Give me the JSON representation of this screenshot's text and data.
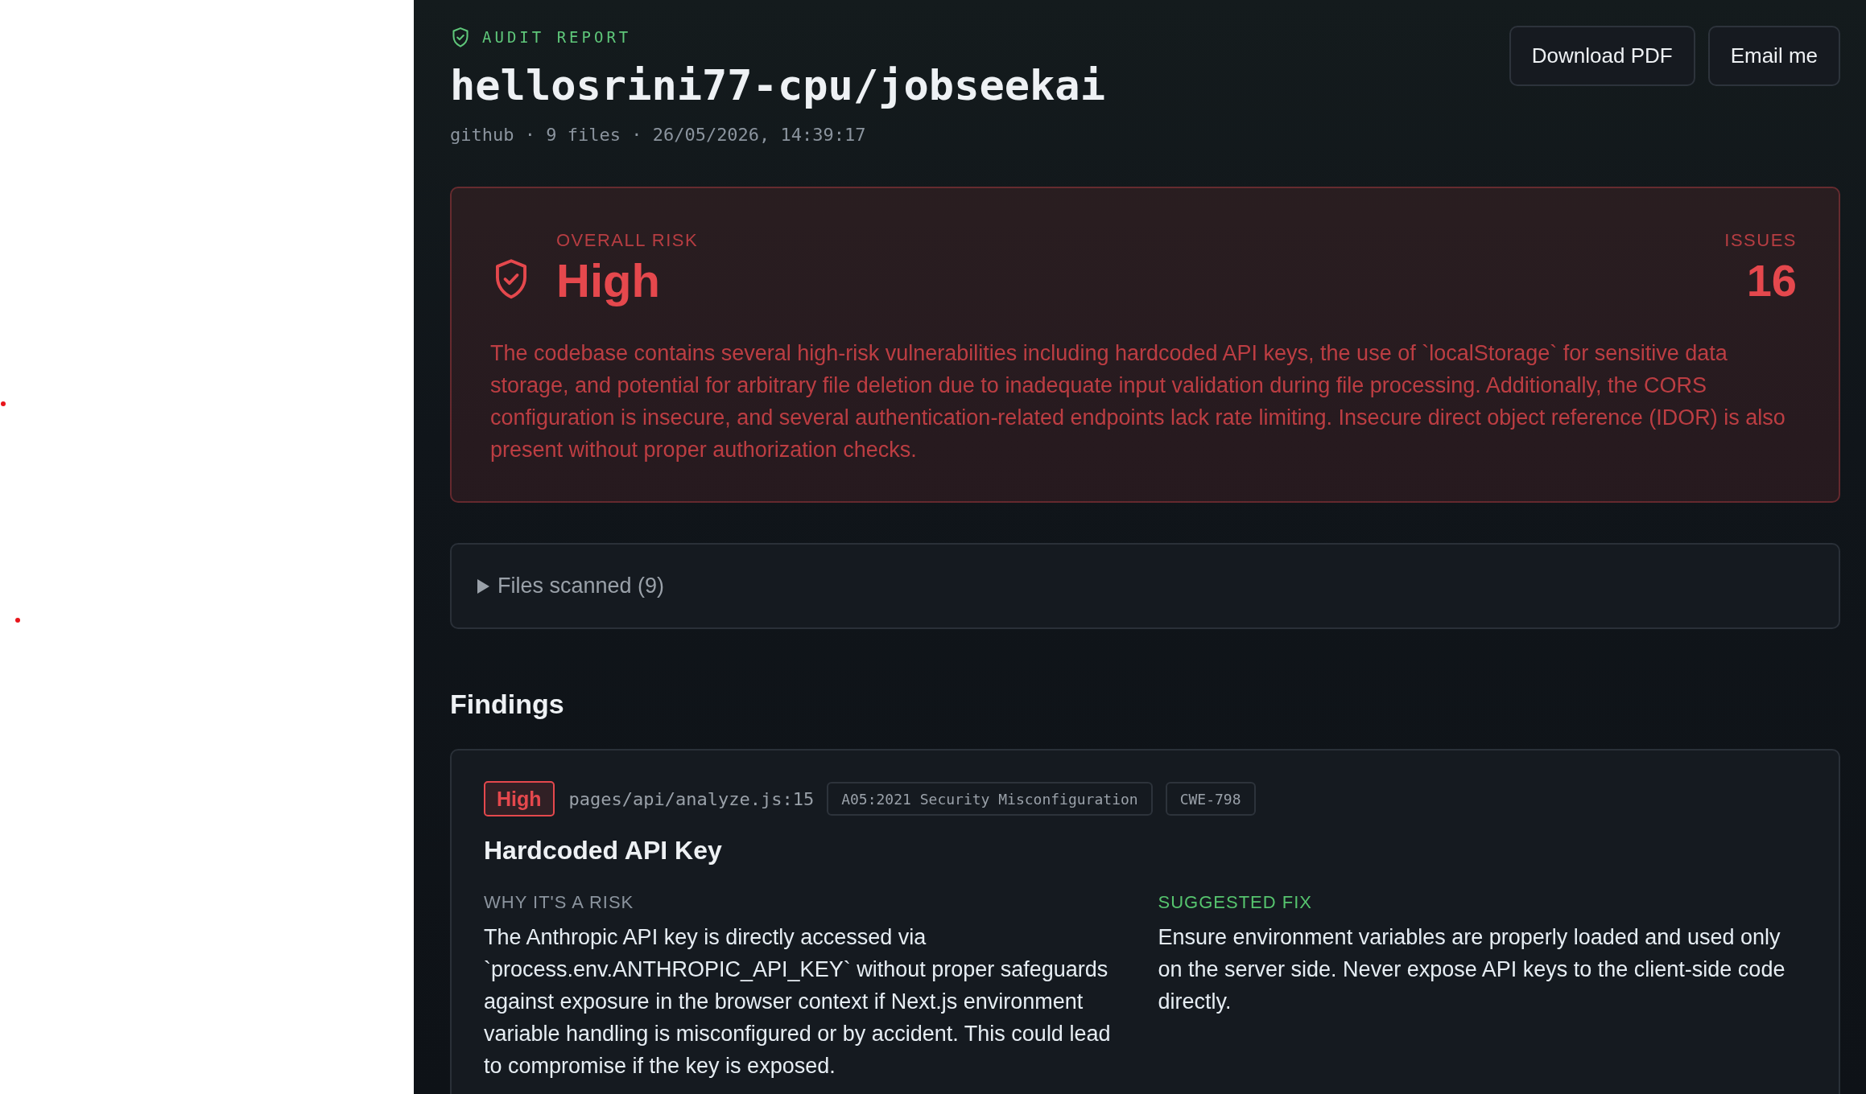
{
  "report": {
    "eyebrow": "AUDIT REPORT",
    "title": "hellosrini77-cpu/jobseekai",
    "meta": "github · 9 files · 26/05/2026, 14:39:17"
  },
  "actions": [
    "Download PDF",
    "Email me"
  ],
  "risk": {
    "label": "OVERALL RISK",
    "value": "High",
    "color": "#e5484d",
    "issues_label": "ISSUES",
    "issues": "16",
    "summary": "The codebase contains several high-risk vulnerabilities including hardcoded API keys, the use of `localStorage` for sensitive data storage, and potential for arbitrary file deletion due to inadequate input validation during file processing. Additionally, the CORS configuration is insecure, and several authentication-related endpoints lack rate limiting. Insecure direct object reference (IDOR) is also present without proper authorization checks."
  },
  "files_scanned": {
    "label": "Files scanned (9)",
    "expanded": false
  },
  "findings": {
    "heading": "Findings",
    "items": [
      {
        "severity": "High",
        "color": "#e5484d",
        "location": "pages/api/analyze.js:15",
        "tags": [
          "A05:2021 Security Misconfiguration",
          "CWE-798"
        ],
        "title": "Hardcoded API Key",
        "risk_label": "WHY IT'S A RISK",
        "risk_text": "The Anthropic API key is directly accessed via `process.env.ANTHROPIC_API_KEY` without proper safeguards against exposure in the browser context if Next.js environment variable handling is misconfigured or by accident. This could lead to compromise if the key is exposed.",
        "fix_label": "SUGGESTED FIX",
        "fix_text": "Ensure environment variables are properly loaded and used only on the server side. Never expose API keys to the client-side code directly."
      }
    ]
  }
}
